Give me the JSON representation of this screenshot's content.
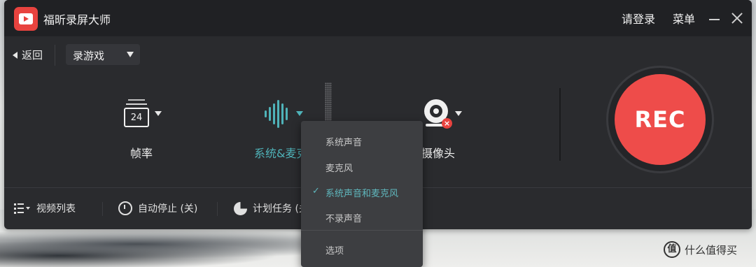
{
  "titlebar": {
    "app_title": "福昕录屏大师",
    "login": "请登录",
    "menu": "菜单"
  },
  "toolbar": {
    "back_label": "返回",
    "mode_select": "录游戏"
  },
  "options": {
    "fps_value": "24",
    "fps_label": "帧率",
    "audio_label": "系统&麦克",
    "camera_label": "摄像头",
    "camera_off_mark": "×"
  },
  "record": {
    "label": "REC",
    "color": "#ee4c4a"
  },
  "bottom": {
    "video_list": "视频列表",
    "auto_stop": "自动停止 (关)",
    "schedule": "计划任务 (关"
  },
  "audio_menu": {
    "items": [
      {
        "label": "系统声音",
        "selected": false
      },
      {
        "label": "麦克风",
        "selected": false
      },
      {
        "label": "系统声音和麦克风",
        "selected": true
      },
      {
        "label": "不录声音",
        "selected": false
      }
    ],
    "check_mark": "✓",
    "options_label": "选项"
  },
  "watermark": {
    "badge": "值",
    "text": "什么值得买"
  },
  "colors": {
    "accent_teal": "#4fb3b9",
    "window_bg": "#2a2b2e",
    "brand_red": "#e8433f"
  },
  "icons": {
    "app_logo": "video-camera-icon",
    "fps": "frame-rate-icon",
    "audio": "sound-wave-icon",
    "camera": "webcam-icon",
    "list": "list-icon",
    "alarm": "alarm-clock-icon",
    "schedule": "pie-clock-icon"
  }
}
